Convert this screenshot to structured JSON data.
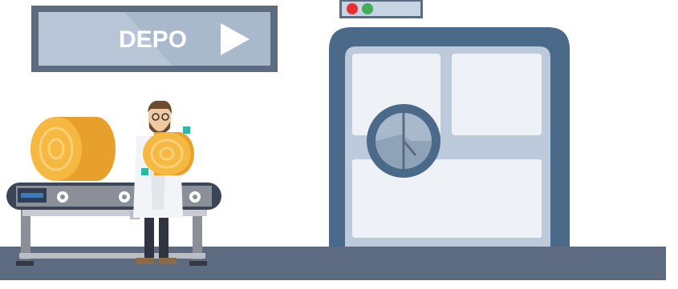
{
  "sign": {
    "label": "DEPO",
    "icon": "play-arrow-icon"
  },
  "indicator_panel": {
    "lights": [
      {
        "name": "red-light",
        "color": "#e8312f"
      },
      {
        "name": "green-light",
        "color": "#3fae5a"
      }
    ]
  },
  "colors": {
    "floor": "#5c6b80",
    "vault_frame": "#4b6a8a",
    "vault_inner": "#bccadb",
    "hay": "#f2b23a",
    "hay_dark": "#d99322",
    "sign_bg": "#a9b9cc",
    "sign_border": "#5c6b80"
  },
  "icons": {
    "conveyor_cogs": [
      "cog-icon",
      "cog-icon",
      "cog-icon",
      "cog-icon"
    ],
    "vault_wheel": "vault-wheel-icon"
  }
}
